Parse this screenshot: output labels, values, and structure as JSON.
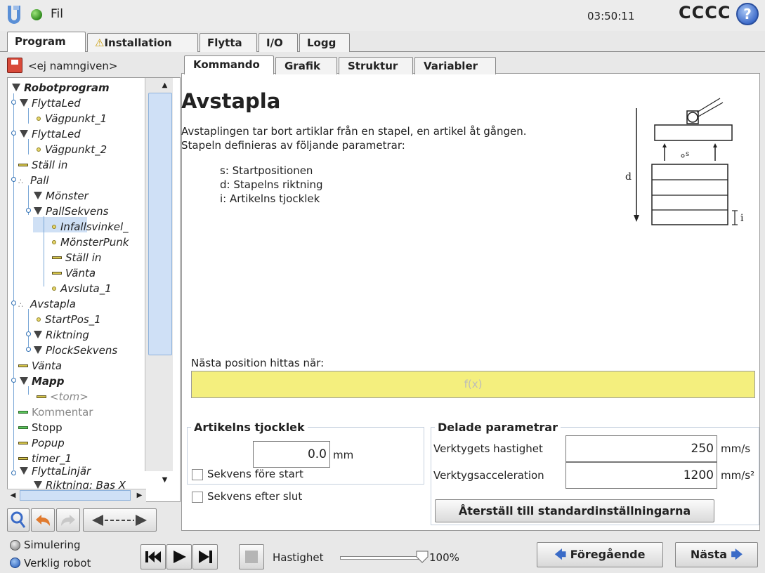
{
  "topbar": {
    "file_label": "Fil",
    "time": "03:50:11",
    "robot_name": "CCCC",
    "help": "?"
  },
  "main_tabs": [
    "Program",
    "Installation",
    "Flytta",
    "I/O",
    "Logg"
  ],
  "program_name": "<ej namngiven>",
  "tree": [
    {
      "label": "Robotprogram"
    },
    {
      "label": "FlyttaLed"
    },
    {
      "label": "Vägpunkt_1"
    },
    {
      "label": "FlyttaLed"
    },
    {
      "label": "Vägpunkt_2"
    },
    {
      "label": "Ställ in"
    },
    {
      "label": "Pall"
    },
    {
      "label": "Mönster"
    },
    {
      "label": "PallSekvens"
    },
    {
      "label": "Infallsvinkel_"
    },
    {
      "label": "MönsterPunk"
    },
    {
      "label": "Ställ in"
    },
    {
      "label": "Vänta"
    },
    {
      "label": "Avsluta_1"
    },
    {
      "label": "Avstapla"
    },
    {
      "label": "StartPos_1"
    },
    {
      "label": "Riktning"
    },
    {
      "label": "PlockSekvens"
    },
    {
      "label": "Vänta"
    },
    {
      "label": "Mapp"
    },
    {
      "label": "<tom>"
    },
    {
      "label": "Kommentar"
    },
    {
      "label": "Stopp"
    },
    {
      "label": "Popup"
    },
    {
      "label": "timer_1"
    },
    {
      "label": "FlyttaLinjär"
    },
    {
      "label": "Riktning: Bas X"
    }
  ],
  "sub_tabs": [
    "Kommando",
    "Grafik",
    "Struktur",
    "Variabler"
  ],
  "content": {
    "title": "Avstapla",
    "desc1": "Avstaplingen tar bort artiklar från en stapel, en artikel åt gången.",
    "desc2": "Stapeln definieras av följande parametrar:",
    "param_s": "s: Startpositionen",
    "param_d": "d: Stapelns riktning",
    "param_i": "i: Artikelns tjocklek",
    "diagram_d": "d",
    "diagram_s": "s",
    "diagram_i": "i",
    "next_pos_label": "Nästa position hittas när:",
    "expression_placeholder": "f(x)",
    "thickness_group": "Artikelns tjocklek",
    "thickness_value": "0.0",
    "thickness_unit": "mm",
    "seq_before": "Sekvens före start",
    "seq_after": "Sekvens efter slut",
    "shared_group": "Delade parametrar",
    "tool_speed_label": "Verktygets hastighet",
    "tool_speed_value": "250",
    "tool_speed_unit": "mm/s",
    "tool_accel_label": "Verktygsacceleration",
    "tool_accel_value": "1200",
    "tool_accel_unit": "mm/s²",
    "reset_button": "Återställ till standardinställningarna"
  },
  "bottom": {
    "simulation": "Simulering",
    "real_robot": "Verklig robot",
    "speed_label": "Hastighet",
    "speed_value": "100%",
    "speed_fraction": 1.0,
    "prev_button": "Föregående",
    "next_button": "Nästa"
  },
  "colors": {
    "selected_row": "#cfe0f5",
    "expression_bg": "#f4ef7e",
    "tree_lines": "#7aa7d6"
  }
}
